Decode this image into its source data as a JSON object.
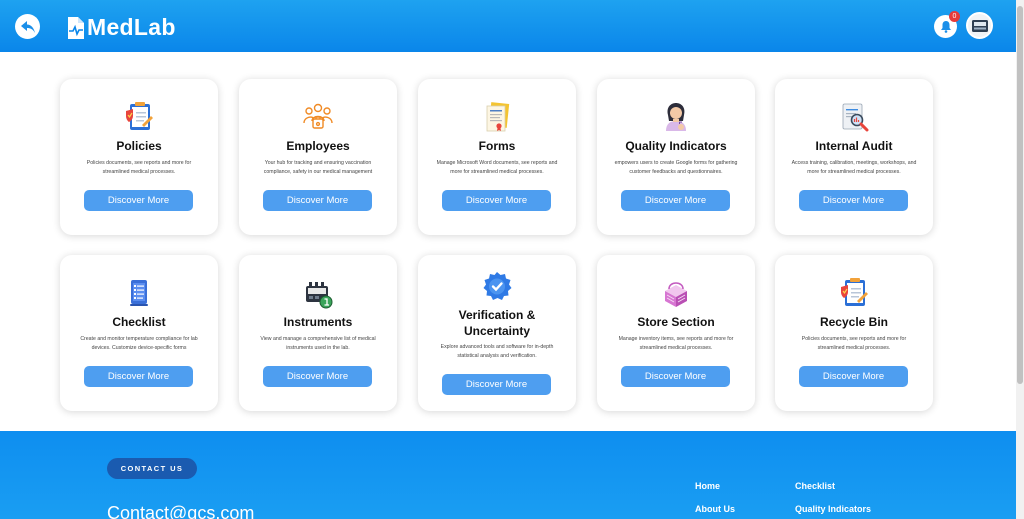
{
  "header": {
    "brand": "MedLab",
    "notification_count": "0"
  },
  "cards": [
    {
      "title": "Policies",
      "description": "Policies documents, see reports and more for streamlined medical processes.",
      "button": "Discover More"
    },
    {
      "title": "Employees",
      "description": "Your hub for tracking and ensuring vaccination compliance, safety in our medical management",
      "button": "Discover More"
    },
    {
      "title": "Forms",
      "description": "Manage Microsoft Word documents, see reports and more for streamlined medical processes.",
      "button": "Discover More"
    },
    {
      "title": "Quality Indicators",
      "description": "empowers users to create Google forms for gathering customer feedbacks and questionnaires.",
      "button": "Discover More"
    },
    {
      "title": "Internal Audit",
      "description": "Access training, calibration, meetings, workshops, and more for streamlined medical processes.",
      "button": "Discover More"
    },
    {
      "title": "Checklist",
      "description": "Create and monitor temperature compliance for lab devices. Customize device-specific forms",
      "button": "Discover More"
    },
    {
      "title": "Instruments",
      "description": "View and manage a comprehensive list of medical instruments used in the lab.",
      "button": "Discover More"
    },
    {
      "title": "Verification & Uncertainty",
      "description": "Explore advanced tools and software for in-depth statistical analysis and verification.",
      "button": "Discover More"
    },
    {
      "title": "Store Section",
      "description": "Manage inventory items, see reports and more for streamlined medical processes.",
      "button": "Discover More"
    },
    {
      "title": "Recycle Bin",
      "description": "Policies documents, see reports and more for streamlined medical processes.",
      "button": "Discover More"
    }
  ],
  "footer": {
    "contact_label": "CONTACT US",
    "email": "Contact@qcs.com",
    "links_col1": [
      "Home",
      "About Us"
    ],
    "links_col2": [
      "Checklist",
      "Quality Indicators"
    ]
  },
  "colors": {
    "header": "#0a86ea",
    "button": "#4e9ef0",
    "footer": "#1a9ef2"
  },
  "icons": [
    "back-arrow-icon",
    "bell-icon",
    "avatar-icon",
    "policies-icon",
    "employees-icon",
    "forms-icon",
    "quality-indicators-icon",
    "internal-audit-icon",
    "checklist-icon",
    "instruments-icon",
    "verification-icon",
    "store-icon",
    "recycle-bin-icon"
  ]
}
